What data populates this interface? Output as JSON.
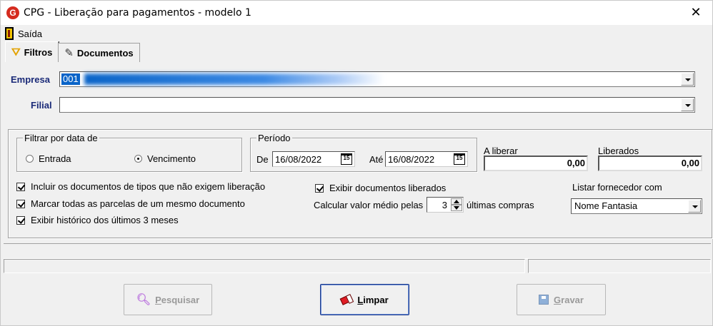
{
  "window": {
    "title": "CPG - Liberação para pagamentos - modelo 1",
    "close_glyph": "✕",
    "app_icon_letter": "G"
  },
  "menu": {
    "exit_label": "Saída"
  },
  "tabs": [
    {
      "label": "Filtros",
      "icon": "funnel-icon",
      "active": true
    },
    {
      "label": "Documentos",
      "icon": "documents-icon",
      "active": false
    }
  ],
  "filters": {
    "empresa_label": "Empresa",
    "empresa_value": "001",
    "filial_label": "Filial",
    "filial_value": "",
    "date_filter": {
      "legend": "Filtrar por data de",
      "options": [
        {
          "label": "Entrada",
          "selected": false
        },
        {
          "label": "Vencimento",
          "selected": true
        }
      ]
    },
    "periodo": {
      "legend": "Período",
      "from_label": "De",
      "from_value": "16/08/2022",
      "to_label": "Até",
      "to_value": "16/08/2022",
      "calendar_glyph": "15"
    },
    "a_liberar": {
      "label": "A liberar",
      "value": "0,00"
    },
    "liberados": {
      "label": "Liberados",
      "value": "0,00"
    },
    "checkboxes": [
      {
        "label": "Incluir os documentos de tipos que não exigem liberação",
        "checked": true
      },
      {
        "label": "Marcar todas as parcelas de um mesmo documento",
        "checked": true
      },
      {
        "label": "Exibir histórico dos últimos 3 meses",
        "checked": true
      },
      {
        "label": "Exibir documentos liberados",
        "checked": true
      }
    ],
    "avg": {
      "prefix": "Calcular valor médio pelas",
      "value": "3",
      "suffix": "últimas compras"
    },
    "fornecedor": {
      "label": "Listar fornecedor com",
      "value": "Nome Fantasia"
    }
  },
  "buttons": {
    "search": {
      "first": "P",
      "rest": "esquisar",
      "enabled": false
    },
    "clear": {
      "first": "L",
      "rest": "impar",
      "enabled": true
    },
    "save": {
      "first": "G",
      "rest": "ravar",
      "enabled": false
    }
  },
  "colors": {
    "label_blue": "#1a2a78",
    "selection": "#0a64c8",
    "disabled_text": "#9a9a9a",
    "primary_border": "#1a3a8c"
  }
}
